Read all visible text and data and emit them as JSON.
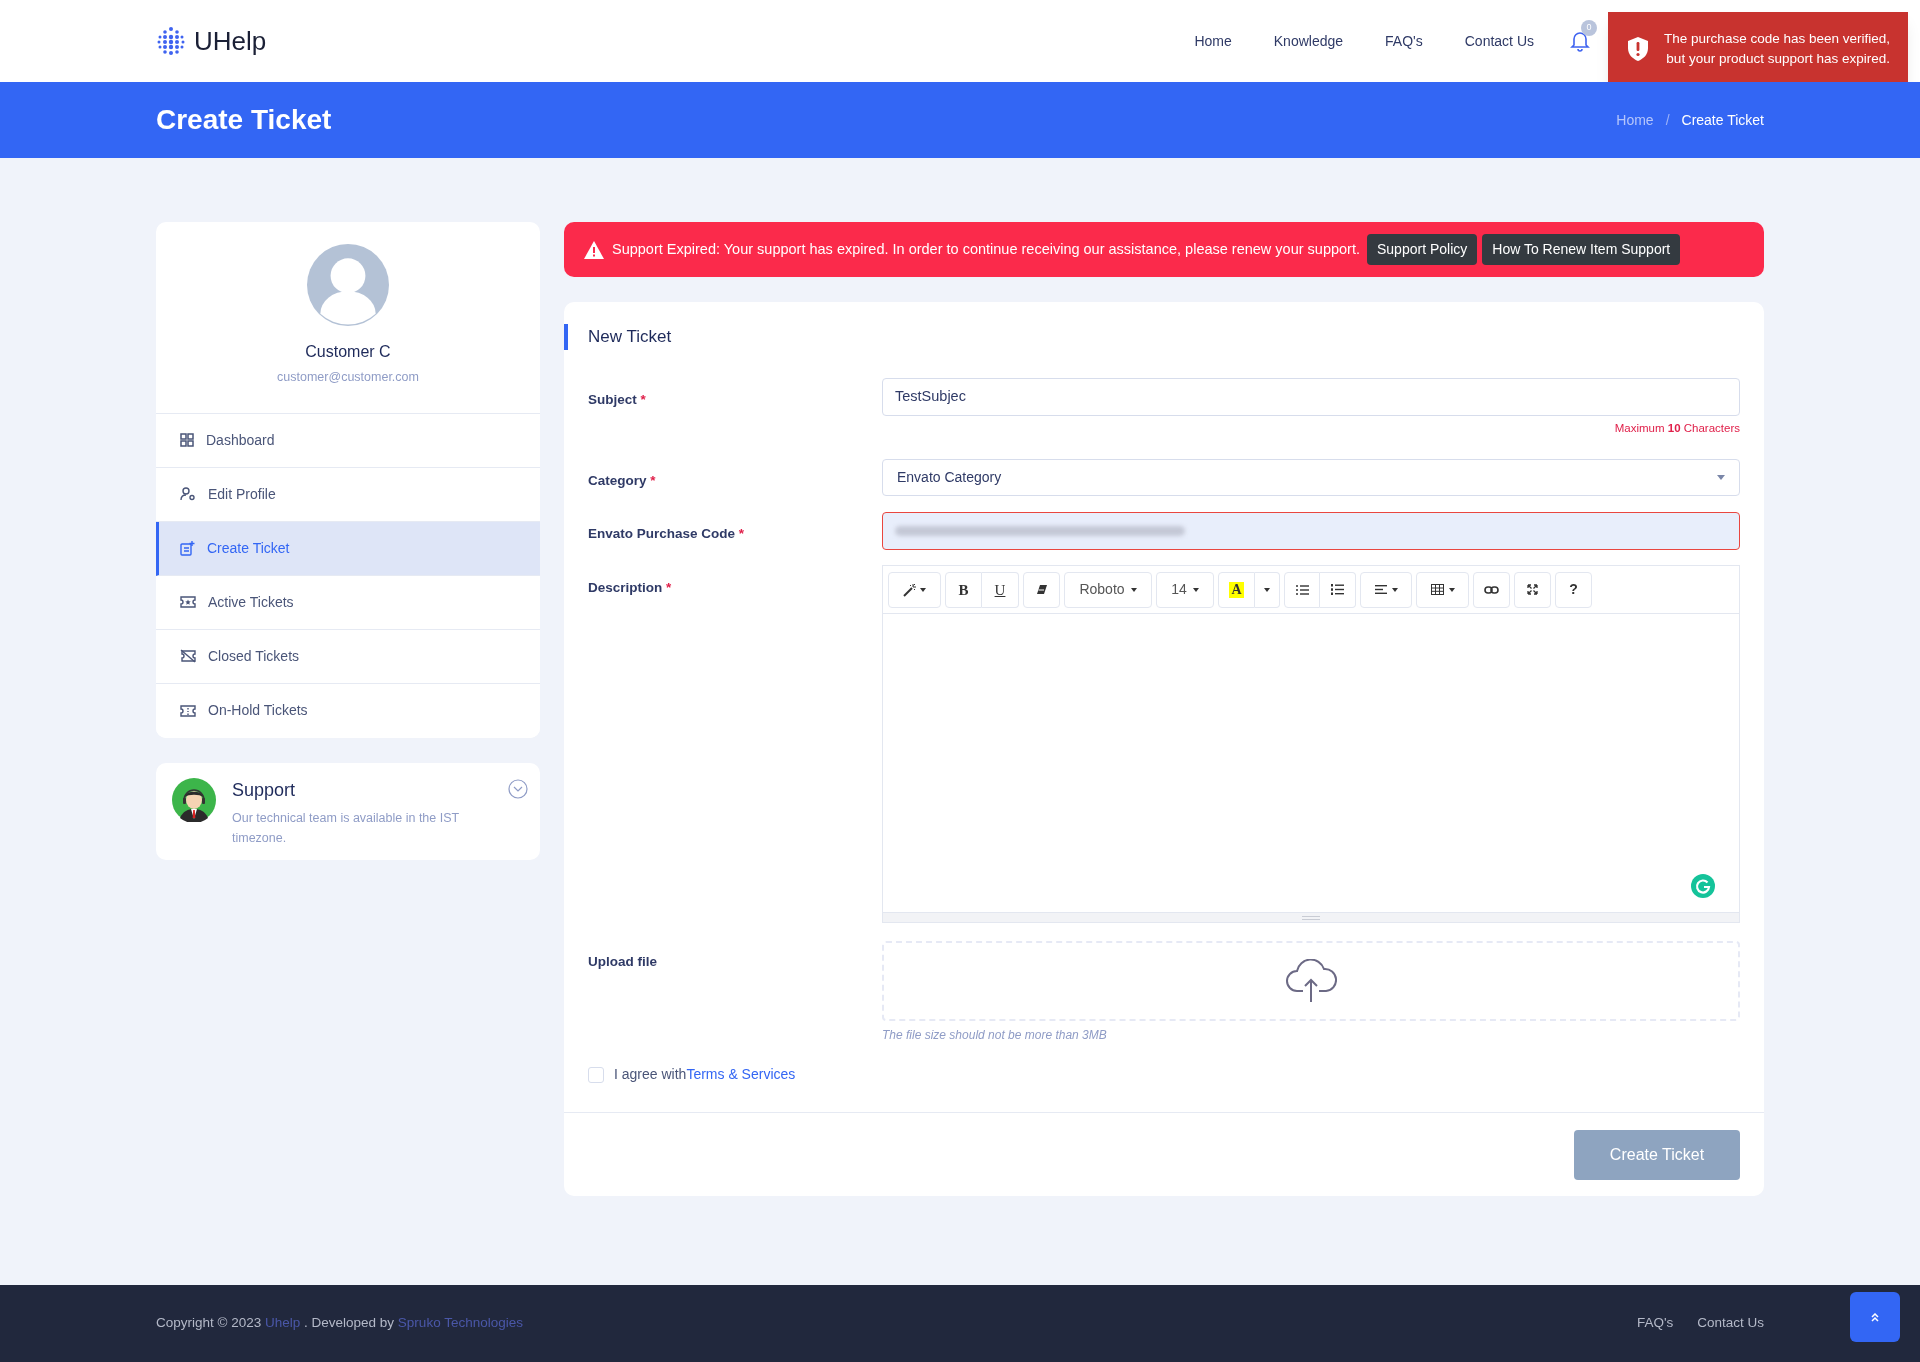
{
  "header": {
    "logo": "UHelp",
    "nav": [
      "Home",
      "Knowledge",
      "FAQ's",
      "Contact Us"
    ],
    "notification_count": "0"
  },
  "toast": {
    "text": "The purchase code has been verified, but your product support has expired."
  },
  "banner": {
    "title": "Create Ticket",
    "breadcrumb": [
      "Home",
      "Create Ticket"
    ],
    "separator": "/"
  },
  "profile": {
    "name": "Customer C",
    "email": "customer@customer.com"
  },
  "menu": [
    {
      "label": "Dashboard",
      "selected": false
    },
    {
      "label": "Edit Profile",
      "selected": false
    },
    {
      "label": "Create Ticket",
      "selected": true
    },
    {
      "label": "Active Tickets",
      "selected": false
    },
    {
      "label": "Closed Tickets",
      "selected": false
    },
    {
      "label": "On-Hold Tickets",
      "selected": false
    }
  ],
  "support": {
    "title": "Support",
    "text": "Our technical team is available in the IST timezone."
  },
  "alert": {
    "text": "Support Expired: Your support has expired. In order to continue receiving our assistance, please renew your support.",
    "buttons": [
      "Support Policy",
      "How To Renew Item Support"
    ]
  },
  "form": {
    "title": "New Ticket",
    "subject": {
      "label": "Subject",
      "mark": "*",
      "value": "TestSubjec",
      "hint": "Maximum **10** Characters"
    },
    "category": {
      "label": "Category",
      "mark": "*",
      "value": "Envato Category"
    },
    "purchase_code": {
      "label": "Envato Purchase Code",
      "mark": "*",
      "invalid": true
    },
    "description": {
      "label": "Description",
      "mark": "*",
      "toolbar": {
        "bold": "B",
        "underline": "U",
        "font": "Roboto",
        "size": "14",
        "highlight_letter": "A",
        "help": "?"
      }
    },
    "upload": {
      "label": "Upload file",
      "hint": "The file size should not be more than 3MB"
    },
    "agree": {
      "label": "I agree with",
      "link": "Terms & Services",
      "checked": false
    },
    "submit": {
      "label": "Create Ticket",
      "disabled": true
    }
  },
  "footer": {
    "copyright": {
      "prefix": "Copyright © 2023 ",
      "brand": "Uhelp",
      "middle": " . Developed by ",
      "developer": "Spruko Technologies"
    },
    "links": [
      "FAQ's",
      "Contact Us"
    ]
  }
}
